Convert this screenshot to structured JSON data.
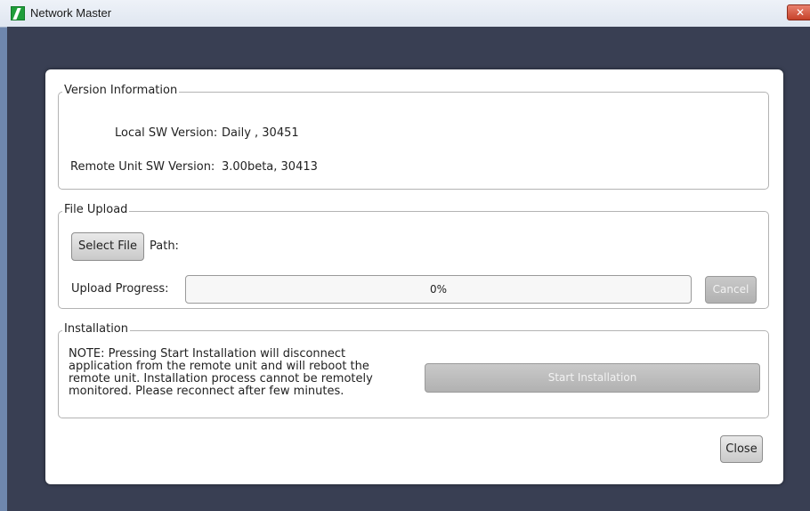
{
  "window": {
    "title": "Network Master",
    "close_glyph": "✕",
    "app_icon": "network-master-app-icon"
  },
  "version_info": {
    "legend": "Version Information",
    "local_label": "Local SW Version:",
    "local_value": "Daily , 30451",
    "remote_label": "Remote Unit SW Version:",
    "remote_value": "3.00beta, 30413"
  },
  "file_upload": {
    "legend": "File Upload",
    "select_file_label": "Select File",
    "path_label": "Path:",
    "progress_label": "Upload Progress:",
    "progress_text": "0%",
    "progress_value": 0,
    "cancel_label": "Cancel"
  },
  "installation": {
    "legend": "Installation",
    "note": "NOTE: Pressing Start Installation will disconnect application from the remote unit and will reboot the remote unit. Installation process cannot be remotely monitored. Please reconnect after few minutes.",
    "start_label": "Start Installation"
  },
  "footer": {
    "close_label": "Close"
  },
  "colors": {
    "client_background": "#393f53",
    "window_frame": "#6f87ad",
    "disabled_button": "#b1b1b1"
  }
}
